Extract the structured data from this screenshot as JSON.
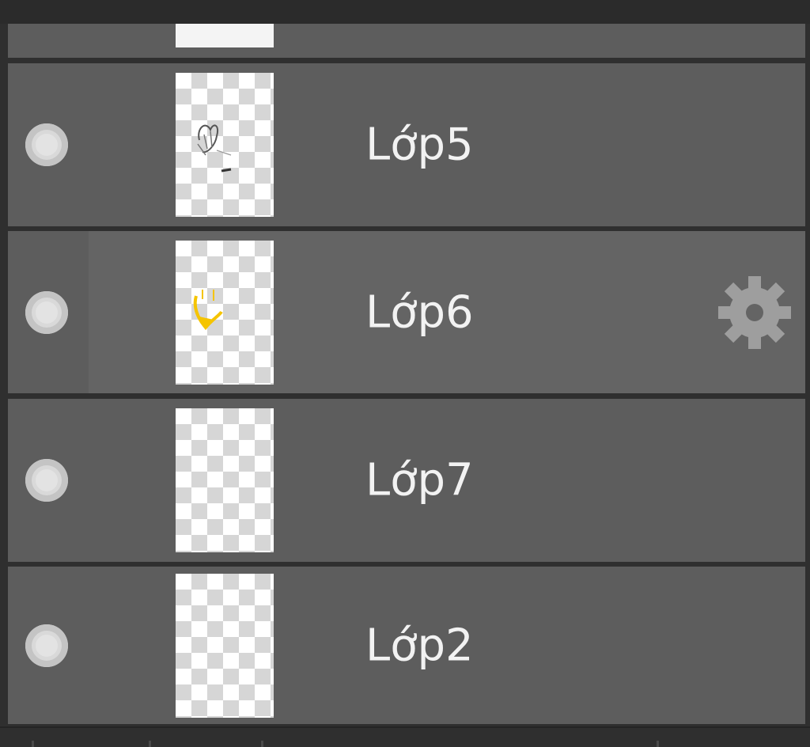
{
  "layers": [
    {
      "name": "Lớp5",
      "thumbnail": "sketch-gray",
      "selected": false
    },
    {
      "name": "Lớp6",
      "thumbnail": "sketch-yellow",
      "selected": true,
      "action_icon": "gear-icon"
    },
    {
      "name": "Lớp7",
      "thumbnail": "empty",
      "selected": false
    },
    {
      "name": "Lớp2",
      "thumbnail": "empty",
      "selected": false
    }
  ],
  "colors": {
    "row_bg": "#5d5d5d",
    "selected_bg": "#646464",
    "panel_bg": "#2f2f2f",
    "text": "#f2f2f2",
    "gear": "#9e9e9e",
    "sketch_yellow": "#f5c400"
  }
}
